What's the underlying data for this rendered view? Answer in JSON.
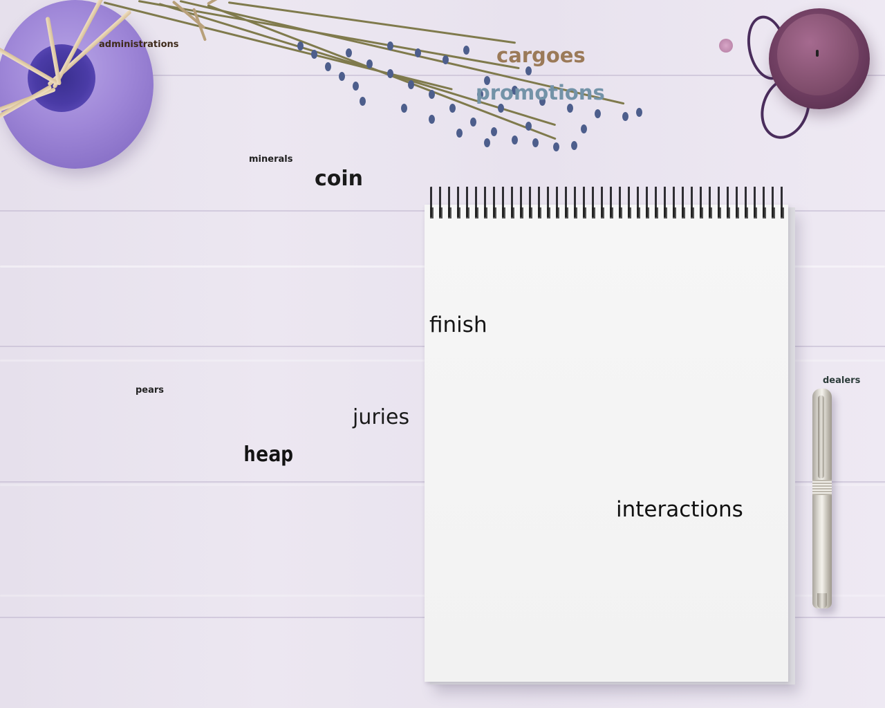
{
  "scene": {
    "background": "lavender wooden tabletop",
    "objects": [
      "diffuser-vase",
      "lavender-bundle",
      "candle",
      "spiral-notebook",
      "pen"
    ]
  },
  "words": {
    "administrations": "administrations",
    "cargoes": "cargoes",
    "promotions": "promotions",
    "minerals": "minerals",
    "coin": "coin",
    "finish": "finish",
    "pears": "pears",
    "juries": "juries",
    "heap": "heap",
    "interactions": "interactions",
    "dealers": "dealers"
  },
  "colors": {
    "table": "#e9e4ef",
    "vase": "#9f87d8",
    "candle": "#83506f",
    "notebook_paper": "#f4f4f4",
    "spiral": "#1b1b1f",
    "cargoes_text": "#9b7a58",
    "promotions_text": "#7393a8"
  }
}
